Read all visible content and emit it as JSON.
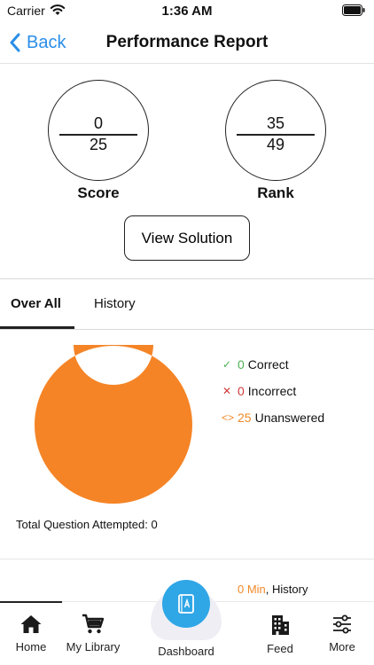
{
  "status_bar": {
    "carrier": "Carrier",
    "time": "1:36 AM"
  },
  "nav": {
    "back_label": "Back",
    "title": "Performance Report"
  },
  "score": {
    "value": "0",
    "total": "25",
    "label": "Score"
  },
  "rank": {
    "value": "35",
    "total": "49",
    "label": "Rank"
  },
  "view_solution_label": "View Solution",
  "tabs": [
    {
      "label": "Over All",
      "active": true
    },
    {
      "label": "History",
      "active": false
    }
  ],
  "chart_data": {
    "type": "pie",
    "categories": [
      "Correct",
      "Incorrect",
      "Unanswered"
    ],
    "values": [
      0,
      0,
      25
    ],
    "colors": [
      "#4caf50",
      "#d0383a",
      "#f58426"
    ]
  },
  "legend": [
    {
      "icon": "check-icon",
      "symbol": "✓",
      "count": "0",
      "label": "Correct",
      "color": "#4caf50"
    },
    {
      "icon": "cross-icon",
      "symbol": "✕",
      "count": "0",
      "label": "Incorrect",
      "color": "#d0383a"
    },
    {
      "icon": "code-icon",
      "symbol": "<>",
      "count": "25",
      "label": "Unanswered",
      "color": "#f08a2a"
    }
  ],
  "total_attempted": "Total Question Attempted: 0",
  "time_history": {
    "value": "0 Min",
    "label": ", History"
  },
  "tab_bar": {
    "home": "Home",
    "library": "My Library",
    "dashboard": "Dashboard",
    "feed": "Feed",
    "more": "More"
  }
}
